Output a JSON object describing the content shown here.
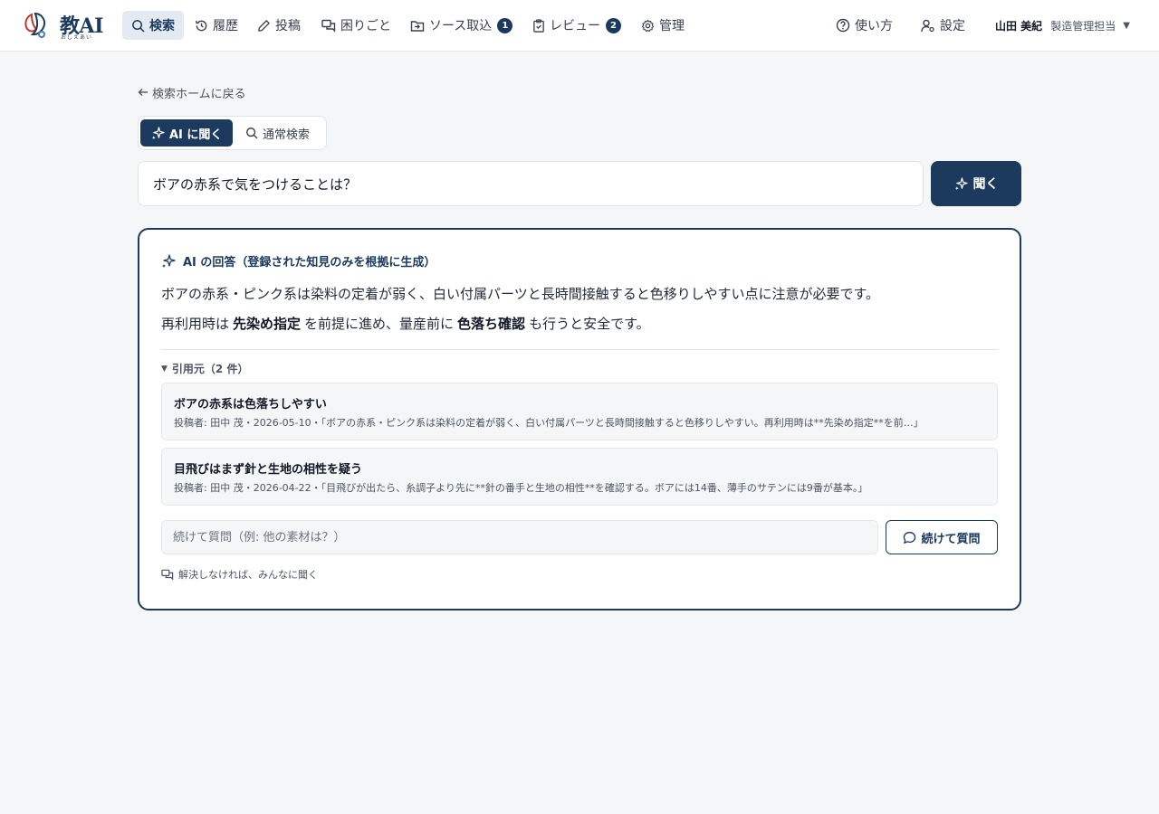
{
  "app": {
    "logo_text": "教AI",
    "logo_sub": "おしえあい"
  },
  "nav": {
    "items": [
      {
        "label": "検索",
        "icon": "search-icon",
        "active": true
      },
      {
        "label": "履歴",
        "icon": "history-icon"
      },
      {
        "label": "投稿",
        "icon": "pencil-icon"
      },
      {
        "label": "困りごと",
        "icon": "chat-bubbles-icon"
      },
      {
        "label": "ソース取込",
        "icon": "import-icon",
        "badge": "1"
      },
      {
        "label": "レビュー",
        "icon": "clipboard-check-icon",
        "badge": "2"
      },
      {
        "label": "管理",
        "icon": "gear-icon"
      }
    ],
    "help_label": "使い方",
    "settings_label": "設定",
    "user_name": "山田 美紀",
    "user_role": "製造管理担当",
    "user_caret": "▼"
  },
  "main": {
    "back_label": "検索ホームに戻る",
    "mode_ai_label": "AI に聞く",
    "mode_normal_label": "通常検索",
    "query": "ボアの赤系で気をつけることは？",
    "ask_label": "聞く"
  },
  "answer": {
    "heading": "AI の回答（登録された知見のみを根拠に生成）",
    "line1": "ボアの赤系・ピンク系は染料の定着が弱く、白い付属パーツと長時間接触すると色移りしやすい点に注意が必要です。",
    "line2_pre": "再利用時は",
    "line2_b1": "先染め指定",
    "line2_mid": "を前提に進め、量産前に",
    "line2_b2": "色落ち確認",
    "line2_post": "も行うと安全です。",
    "citations_label": "引用元（2 件）",
    "citations": [
      {
        "title": "ボアの赤系は色落ちしやすい",
        "meta": "投稿者: 田中 茂・2026-05-10・「ボアの赤系・ピンク系は染料の定着が弱く、白い付属パーツと長時間接触すると色移りしやすい。再利用時は**先染め指定**を前…」"
      },
      {
        "title": "目飛びはまず針と生地の相性を疑う",
        "meta": "投稿者: 田中 茂・2026-04-22・「目飛びが出たら、糸調子より先に**針の番手と生地の相性**を確認する。ボアには14番、薄手のサテンには9番が基本。」"
      }
    ],
    "followup_placeholder": "続けて質問（例: 他の素材は？）",
    "followup_button_label": "続けて質問",
    "ask_everyone_label": "解決しなければ、みんなに聞く"
  },
  "colors": {
    "accent": "#1c3a5e",
    "background": "#f4f6f8"
  }
}
